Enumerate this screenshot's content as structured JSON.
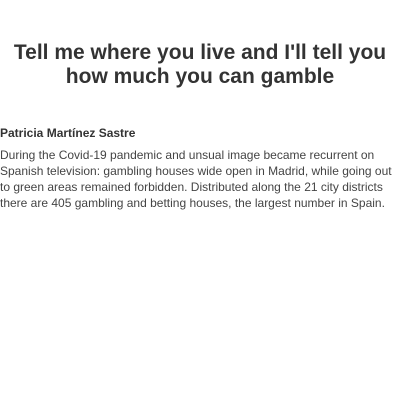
{
  "article": {
    "title": "Tell me where you live and I'll tell you how much you can gamble",
    "author": "Patricia Martínez Sastre",
    "summary": "During the Covid-19 pandemic and unsual image became recurrent on Spanish television: gambling houses wide open in Madrid, while going out to green areas remained forbidden. Distributed along the 21 city districts there are 405 gambling and betting houses, the largest number in Spain."
  }
}
